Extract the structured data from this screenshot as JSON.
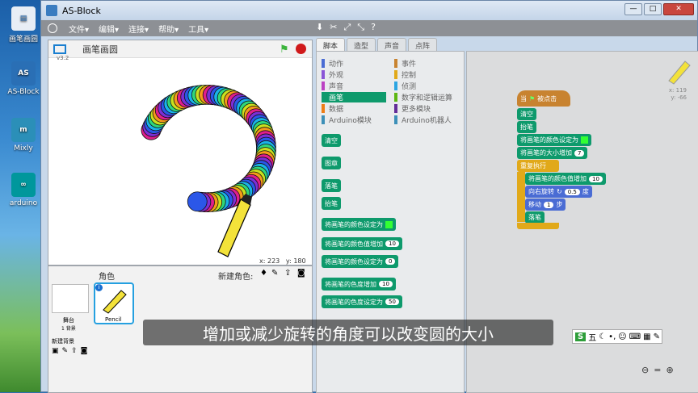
{
  "desktop": {
    "icons": [
      {
        "label": "画笔画圆",
        "color": "#e8eef5"
      },
      {
        "label": "AS-Block",
        "color": "#2a6fb5"
      },
      {
        "label": "Mixly",
        "color": "#2b8fb8"
      },
      {
        "label": "arduino",
        "color": "#00979c"
      }
    ]
  },
  "window": {
    "title": "AS-Block",
    "btns": [
      "—",
      "□",
      "✕"
    ]
  },
  "menu": {
    "items": [
      "文件▾",
      "编辑▾",
      "连接▾",
      "帮助▾",
      "工具▾"
    ]
  },
  "stage": {
    "title": "画笔画圆",
    "version": "v3.2",
    "x_label": "x:",
    "x": "223",
    "y_label": "y:",
    "y": "180"
  },
  "sprites": {
    "header": "角色",
    "new_sprite": "新建角色:",
    "stage_label": "舞台",
    "backdrop_count": "1 背景",
    "new_backdrop": "新建背景",
    "sprite_name": "Pencil"
  },
  "tabs": [
    "脚本",
    "造型",
    "声音",
    "点阵"
  ],
  "categories": {
    "left": [
      {
        "label": "动作",
        "color": "#4a6cd4"
      },
      {
        "label": "外观",
        "color": "#8a55d7"
      },
      {
        "label": "声音",
        "color": "#bb42c3"
      },
      {
        "label": "画笔",
        "color": "#0e9a6c"
      },
      {
        "label": "数据",
        "color": "#ee7d16"
      },
      {
        "label": "Arduino模块",
        "color": "#3c8fb8"
      }
    ],
    "right": [
      {
        "label": "事件",
        "color": "#c88330"
      },
      {
        "label": "控制",
        "color": "#e1a91a"
      },
      {
        "label": "侦测",
        "color": "#2ca5e2"
      },
      {
        "label": "数字和逻辑运算",
        "color": "#5cb712"
      },
      {
        "label": "更多模块",
        "color": "#632d99"
      },
      {
        "label": "Arduino机器人",
        "color": "#3c8fb8"
      }
    ]
  },
  "palette_blocks": [
    {
      "label": "清空",
      "slot": ""
    },
    {
      "label": "图章",
      "slot": ""
    },
    {
      "label": "落笔",
      "slot": ""
    },
    {
      "label": "抬笔",
      "slot": ""
    },
    {
      "label": "将画笔的颜色设定为",
      "slot": ""
    },
    {
      "label": "将画笔的颜色值增加",
      "slot": "10"
    },
    {
      "label": "将画笔的颜色设定为",
      "slot": "0"
    },
    {
      "label": "将画笔的色度增加",
      "slot": "10"
    },
    {
      "label": "将画笔的色度设定为",
      "slot": "50"
    }
  ],
  "script": {
    "hat_when": "当",
    "hat_clicked": "被点击",
    "clear": "清空",
    "pen_up": "抬笔",
    "set_color": "将画笔的颜色设定为",
    "change_size": "将画笔的大小增加",
    "change_size_val": "7",
    "forever": "重复执行",
    "change_color": "将画笔的颜色值增加",
    "change_color_val": "10",
    "turn": "向右旋转",
    "turn_val": "0.5",
    "degrees": "度",
    "move": "移动",
    "move_val": "1",
    "steps": "步",
    "pen_down": "落笔"
  },
  "sprite_info": {
    "x_label": "x:",
    "x": "119",
    "y_label": "y:",
    "y": "-66"
  },
  "subtitle": "增加或减少旋转的角度可以改变圆的大小",
  "ime": {
    "logo": "S",
    "mode": "五"
  },
  "zoom": {
    "out": "🔍",
    "reset": "=",
    "in": "🔍"
  }
}
